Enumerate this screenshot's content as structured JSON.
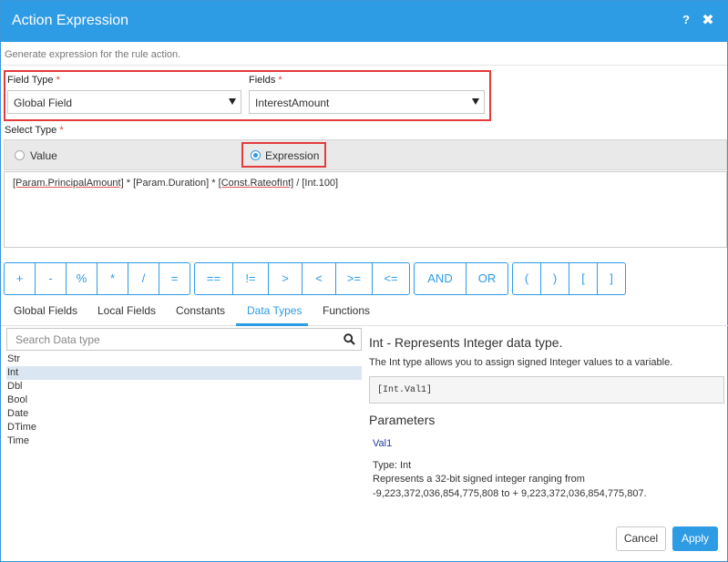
{
  "dialog": {
    "title": "Action Expression",
    "help_label": "?",
    "close_label": "✖",
    "subtitle": "Generate expression for the rule action."
  },
  "field_type": {
    "label": "Field Type",
    "required": "*",
    "value": "Global Field"
  },
  "fields": {
    "label": "Fields",
    "required": "*",
    "value": "InterestAmount"
  },
  "select_type": {
    "label": "Select Type",
    "required": "*",
    "options": [
      "Value",
      "Expression"
    ],
    "selected": "Expression"
  },
  "expression": {
    "parts": [
      "[Param.PrincipalAmount]",
      " * ",
      "[Param.Duration]",
      " * ",
      "[Const.RateofInt]",
      " / [Int.100]"
    ]
  },
  "operators": {
    "arith": [
      "+",
      "-",
      "%",
      "*",
      "/",
      "="
    ],
    "compare": [
      "==",
      "!=",
      ">",
      "<",
      ">=",
      "<="
    ],
    "logical": [
      "AND",
      "OR"
    ],
    "brackets": [
      "(",
      ")",
      "[",
      "]"
    ]
  },
  "tabs": [
    "Global Fields",
    "Local Fields",
    "Constants",
    "Data Types",
    "Functions"
  ],
  "active_tab": "Data Types",
  "search": {
    "placeholder": "Search Data type"
  },
  "data_types": [
    "Str",
    "Int",
    "Dbl",
    "Bool",
    "Date",
    "DTime",
    "Time"
  ],
  "selected_data_type": "Int",
  "detail": {
    "title": "Int - Represents Integer data type.",
    "description": "The Int type allows you to assign signed Integer values to a variable.",
    "code": "[Int.Val1]",
    "parameters_title": "Parameters",
    "param_name": "Val1",
    "param_type": "Type: Int",
    "param_desc_1": "Represents a 32-bit signed integer ranging from",
    "param_desc_2": "-9,223,372,036,854,775,808 to + 9,223,372,036,854,775,807."
  },
  "footer": {
    "cancel_label": "Cancel",
    "apply_label": "Apply"
  },
  "colors": {
    "accent": "#2e9be5",
    "highlight": "#e53b3b",
    "selected_row": "#dbe6f3"
  }
}
